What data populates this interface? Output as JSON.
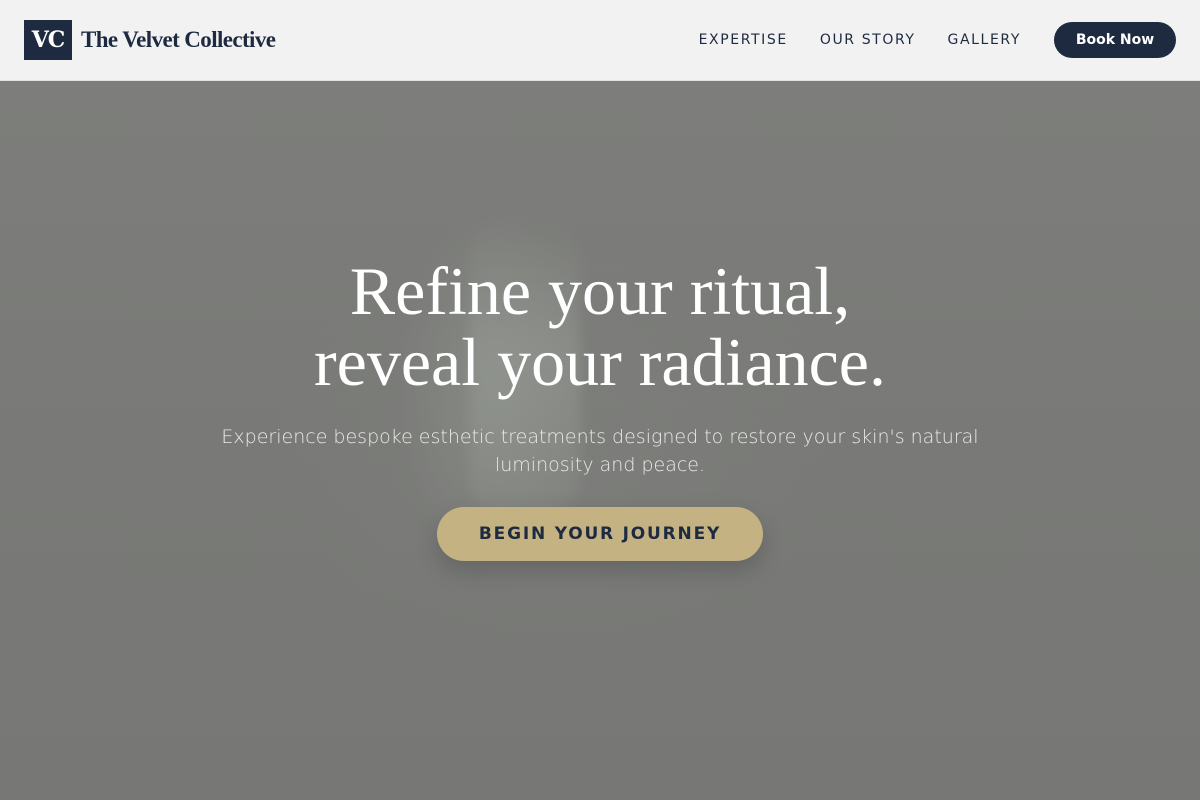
{
  "header": {
    "logo_initials": "VC",
    "brand_name": "The Velvet Collective",
    "nav": {
      "items": [
        "EXPERTISE",
        "OUR STORY",
        "GALLERY"
      ]
    },
    "book_button_label": "Book Now"
  },
  "hero": {
    "title_line1": "Refine your ritual,",
    "title_line2": "reveal your radiance.",
    "subtitle": "Experience bespoke esthetic treatments designed to restore your skin's natural luminosity and peace.",
    "cta_label": "BEGIN YOUR JOURNEY"
  },
  "colors": {
    "navy": "#1e2a40",
    "gold": "#c4b283",
    "header_bg": "#f2f2f2",
    "hero_overlay": "#7b7c79"
  }
}
